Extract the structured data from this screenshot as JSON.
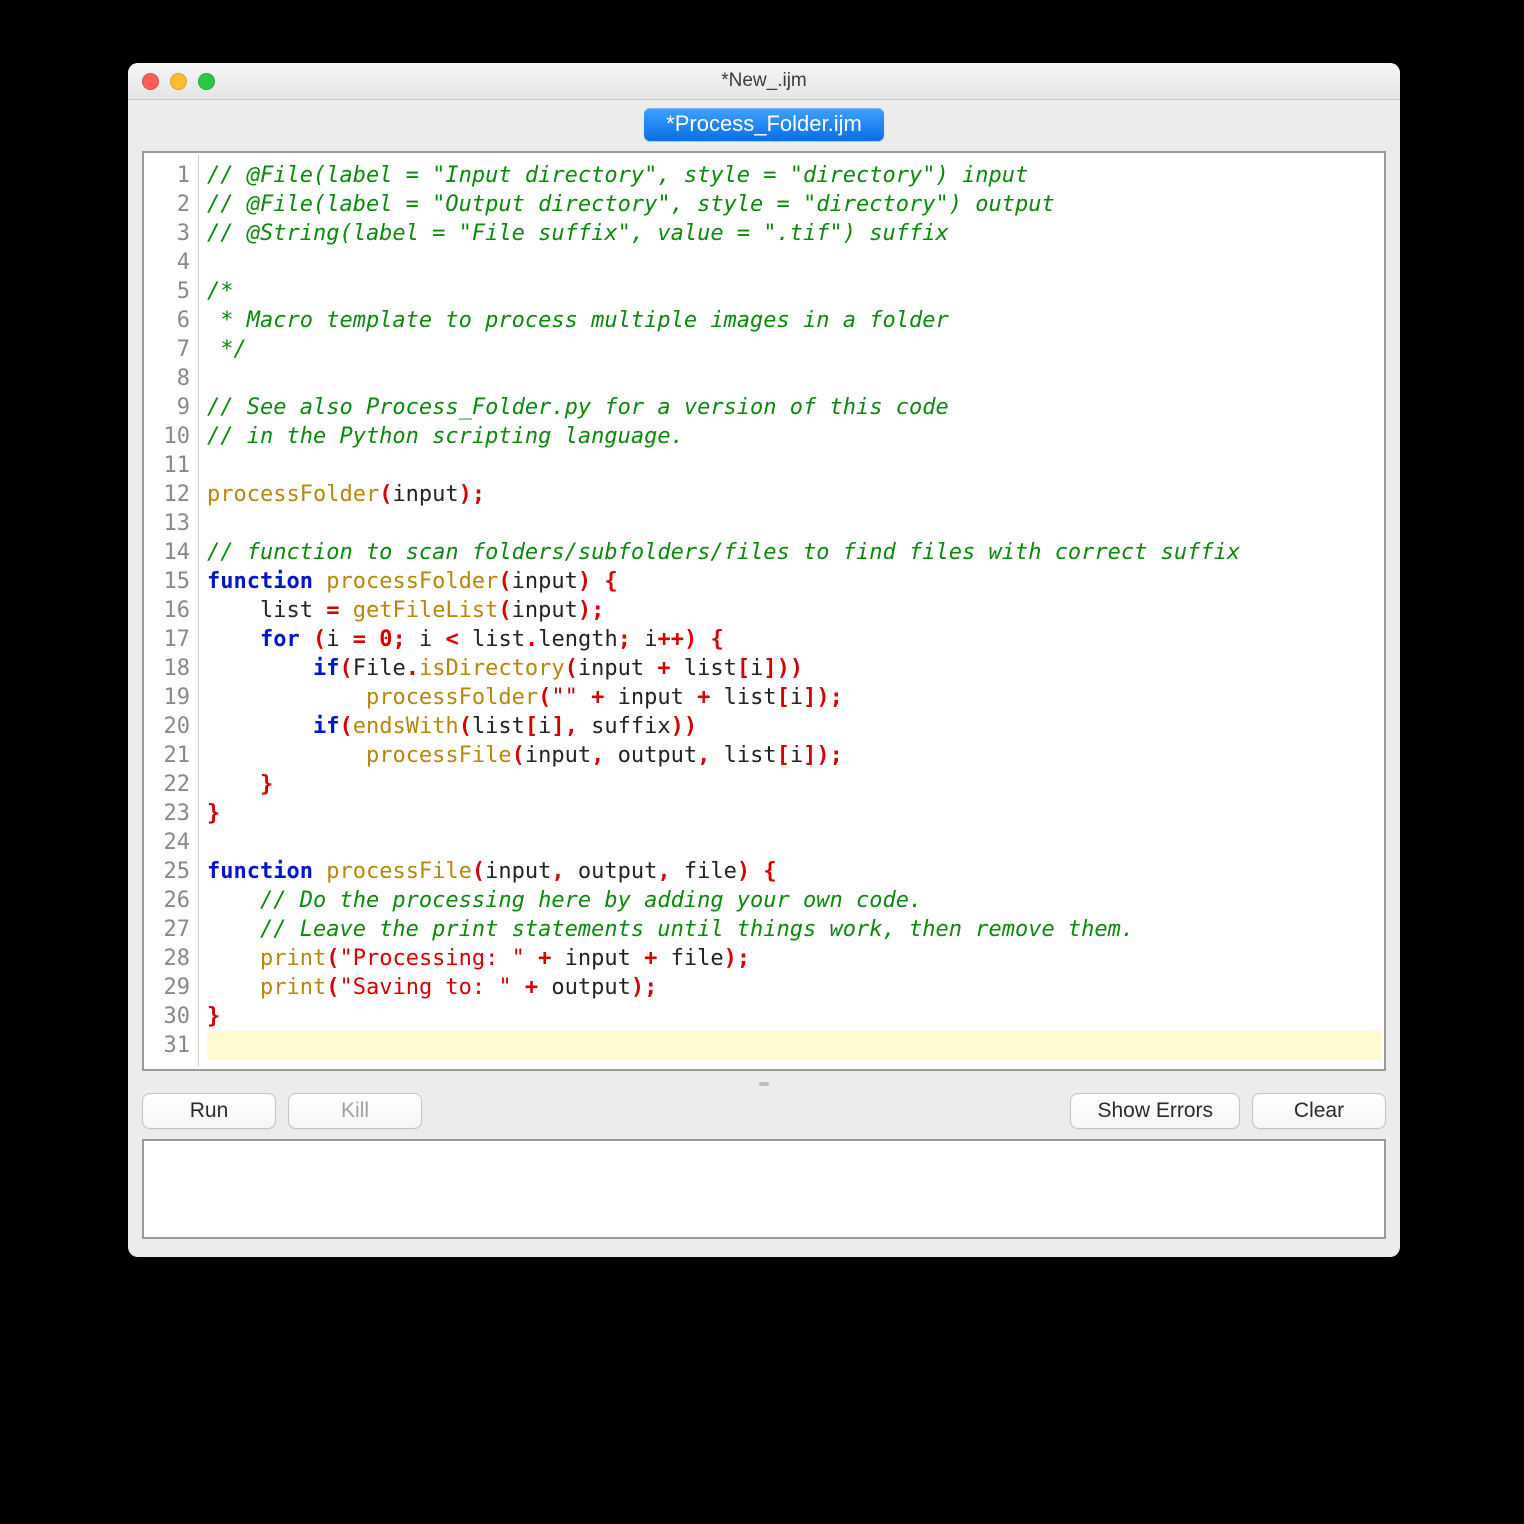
{
  "window_title": "*New_.ijm",
  "tab_label": "*Process_Folder.ijm",
  "buttons": {
    "run": "Run",
    "kill": "Kill",
    "show_errors": "Show Errors",
    "clear": "Clear"
  },
  "line_count": 31,
  "cursor_line": 31,
  "code_lines": [
    [
      [
        "comment",
        "// @File(label = \"Input directory\", style = \"directory\") input"
      ]
    ],
    [
      [
        "comment",
        "// @File(label = \"Output directory\", style = \"directory\") output"
      ]
    ],
    [
      [
        "comment",
        "// @String(label = \"File suffix\", value = \".tif\") suffix"
      ]
    ],
    [],
    [
      [
        "comment",
        "/*"
      ]
    ],
    [
      [
        "comment",
        " * Macro template to process multiple images in a folder"
      ]
    ],
    [
      [
        "comment",
        " */"
      ]
    ],
    [],
    [
      [
        "comment",
        "// See also Process_Folder.py for a version of this code"
      ]
    ],
    [
      [
        "comment",
        "// in the Python scripting language."
      ]
    ],
    [],
    [
      [
        "func",
        "processFolder"
      ],
      [
        "punct",
        "("
      ],
      [
        "plain",
        "input"
      ],
      [
        "punct",
        ")"
      ],
      [
        "punct",
        ";"
      ]
    ],
    [],
    [
      [
        "comment",
        "// function to scan folders/subfolders/files to find files with correct suffix"
      ]
    ],
    [
      [
        "keyword",
        "function"
      ],
      [
        "plain",
        " "
      ],
      [
        "func",
        "processFolder"
      ],
      [
        "punct",
        "("
      ],
      [
        "plain",
        "input"
      ],
      [
        "punct",
        ")"
      ],
      [
        "plain",
        " "
      ],
      [
        "punct",
        "{"
      ]
    ],
    [
      [
        "plain",
        "    list "
      ],
      [
        "punct",
        "="
      ],
      [
        "plain",
        " "
      ],
      [
        "func",
        "getFileList"
      ],
      [
        "punct",
        "("
      ],
      [
        "plain",
        "input"
      ],
      [
        "punct",
        ")"
      ],
      [
        "punct",
        ";"
      ]
    ],
    [
      [
        "plain",
        "    "
      ],
      [
        "keyword",
        "for"
      ],
      [
        "plain",
        " "
      ],
      [
        "punct",
        "("
      ],
      [
        "plain",
        "i "
      ],
      [
        "punct",
        "="
      ],
      [
        "plain",
        " "
      ],
      [
        "num",
        "0"
      ],
      [
        "punct",
        ";"
      ],
      [
        "plain",
        " i "
      ],
      [
        "punct",
        "<"
      ],
      [
        "plain",
        " list"
      ],
      [
        "punct",
        "."
      ],
      [
        "plain",
        "length"
      ],
      [
        "punct",
        ";"
      ],
      [
        "plain",
        " i"
      ],
      [
        "punct",
        "++"
      ],
      [
        "punct",
        ")"
      ],
      [
        "plain",
        " "
      ],
      [
        "punct",
        "{"
      ]
    ],
    [
      [
        "plain",
        "        "
      ],
      [
        "keyword",
        "if"
      ],
      [
        "punct",
        "("
      ],
      [
        "plain",
        "File"
      ],
      [
        "punct",
        "."
      ],
      [
        "func",
        "isDirectory"
      ],
      [
        "punct",
        "("
      ],
      [
        "plain",
        "input "
      ],
      [
        "punct",
        "+"
      ],
      [
        "plain",
        " list"
      ],
      [
        "punct",
        "["
      ],
      [
        "plain",
        "i"
      ],
      [
        "punct",
        "]"
      ],
      [
        "punct",
        ")"
      ],
      [
        "punct",
        ")"
      ]
    ],
    [
      [
        "plain",
        "            "
      ],
      [
        "func",
        "processFolder"
      ],
      [
        "punct",
        "("
      ],
      [
        "string",
        "\"\""
      ],
      [
        "plain",
        " "
      ],
      [
        "punct",
        "+"
      ],
      [
        "plain",
        " input "
      ],
      [
        "punct",
        "+"
      ],
      [
        "plain",
        " list"
      ],
      [
        "punct",
        "["
      ],
      [
        "plain",
        "i"
      ],
      [
        "punct",
        "]"
      ],
      [
        "punct",
        ")"
      ],
      [
        "punct",
        ";"
      ]
    ],
    [
      [
        "plain",
        "        "
      ],
      [
        "keyword",
        "if"
      ],
      [
        "punct",
        "("
      ],
      [
        "func",
        "endsWith"
      ],
      [
        "punct",
        "("
      ],
      [
        "plain",
        "list"
      ],
      [
        "punct",
        "["
      ],
      [
        "plain",
        "i"
      ],
      [
        "punct",
        "]"
      ],
      [
        "punct",
        ","
      ],
      [
        "plain",
        " suffix"
      ],
      [
        "punct",
        ")"
      ],
      [
        "punct",
        ")"
      ]
    ],
    [
      [
        "plain",
        "            "
      ],
      [
        "func",
        "processFile"
      ],
      [
        "punct",
        "("
      ],
      [
        "plain",
        "input"
      ],
      [
        "punct",
        ","
      ],
      [
        "plain",
        " output"
      ],
      [
        "punct",
        ","
      ],
      [
        "plain",
        " list"
      ],
      [
        "punct",
        "["
      ],
      [
        "plain",
        "i"
      ],
      [
        "punct",
        "]"
      ],
      [
        "punct",
        ")"
      ],
      [
        "punct",
        ";"
      ]
    ],
    [
      [
        "plain",
        "    "
      ],
      [
        "punct",
        "}"
      ]
    ],
    [
      [
        "punct",
        "}"
      ]
    ],
    [],
    [
      [
        "keyword",
        "function"
      ],
      [
        "plain",
        " "
      ],
      [
        "func",
        "processFile"
      ],
      [
        "punct",
        "("
      ],
      [
        "plain",
        "input"
      ],
      [
        "punct",
        ","
      ],
      [
        "plain",
        " output"
      ],
      [
        "punct",
        ","
      ],
      [
        "plain",
        " file"
      ],
      [
        "punct",
        ")"
      ],
      [
        "plain",
        " "
      ],
      [
        "punct",
        "{"
      ]
    ],
    [
      [
        "plain",
        "    "
      ],
      [
        "comment",
        "// Do the processing here by adding your own code."
      ]
    ],
    [
      [
        "plain",
        "    "
      ],
      [
        "comment",
        "// Leave the print statements until things work, then remove them."
      ]
    ],
    [
      [
        "plain",
        "    "
      ],
      [
        "func",
        "print"
      ],
      [
        "punct",
        "("
      ],
      [
        "string",
        "\"Processing: \""
      ],
      [
        "plain",
        " "
      ],
      [
        "punct",
        "+"
      ],
      [
        "plain",
        " input "
      ],
      [
        "punct",
        "+"
      ],
      [
        "plain",
        " file"
      ],
      [
        "punct",
        ")"
      ],
      [
        "punct",
        ";"
      ]
    ],
    [
      [
        "plain",
        "    "
      ],
      [
        "func",
        "print"
      ],
      [
        "punct",
        "("
      ],
      [
        "string",
        "\"Saving to: \""
      ],
      [
        "plain",
        " "
      ],
      [
        "punct",
        "+"
      ],
      [
        "plain",
        " output"
      ],
      [
        "punct",
        ")"
      ],
      [
        "punct",
        ";"
      ]
    ],
    [
      [
        "punct",
        "}"
      ]
    ],
    []
  ]
}
